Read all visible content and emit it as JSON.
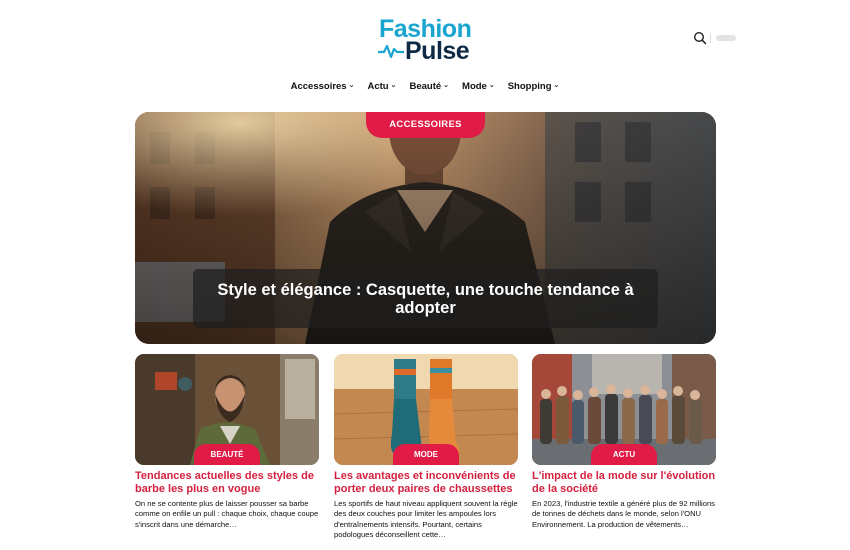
{
  "brand": {
    "name_top": "Fashion",
    "name_bottom": "Pulse",
    "color_primary": "#1aa5d0",
    "color_dark": "#0f2a44",
    "accent": "#e01b46"
  },
  "header": {
    "search_icon": "search-icon",
    "theme_toggle": "theme-toggle"
  },
  "nav": {
    "items": [
      {
        "label": "Accessoires"
      },
      {
        "label": "Actu"
      },
      {
        "label": "Beauté"
      },
      {
        "label": "Mode"
      },
      {
        "label": "Shopping"
      }
    ]
  },
  "hero": {
    "category": "ACCESSOIRES",
    "title": "Style et élégance : Casquette, une touche tendance à adopter"
  },
  "cards": [
    {
      "category": "BEAUTÉ",
      "title": "Tendances actuelles des styles de barbe les plus en vogue",
      "excerpt": "On ne se contente plus de laisser pousser sa barbe comme on enfile un pull : chaque choix, chaque coupe s'inscrit dans une démarche…"
    },
    {
      "category": "MODE",
      "title": "Les avantages et inconvénients de porter deux paires de chaussettes",
      "excerpt": "Les sportifs de haut niveau appliquent souvent la règle des deux couches pour limiter les ampoules lors d'entraînements intensifs. Pourtant, certains podologues déconseillent cette…"
    },
    {
      "category": "ACTU",
      "title": "L'impact de la mode sur l'évolution de la société",
      "excerpt": "En 2023, l'industrie textile a généré plus de 92 millions de tonnes de déchets dans le monde, selon l'ONU Environnement. La production de vêtements…"
    }
  ]
}
